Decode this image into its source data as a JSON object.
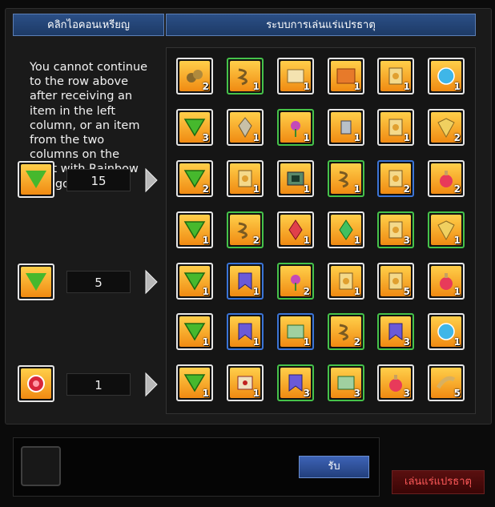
{
  "header": {
    "left_title": "คลิกไอคอนเหรียญ",
    "right_title": "ระบบการเล่นแร่แปรธาตุ"
  },
  "notice_text": "You cannot continue to the row above after receiving an item in the left column, or an item from the two columns on the right with Rainbow Paragon's Soul.",
  "left_rows": [
    {
      "value": "15",
      "icon": "green-down-arrow-icon"
    },
    {
      "value": "5",
      "icon": "green-down-arrow-icon"
    },
    {
      "value": "1",
      "icon": "red-gem-icon"
    }
  ],
  "grid": [
    [
      {
        "icon": "ore-icon",
        "count": "2"
      },
      {
        "icon": "rope-icon",
        "count": "1"
      },
      {
        "icon": "scroll-icon",
        "count": "1"
      },
      {
        "icon": "map-icon",
        "count": "1"
      },
      {
        "icon": "card-icon",
        "count": "1"
      },
      {
        "icon": "orb-icon",
        "count": "1"
      }
    ],
    [
      {
        "icon": "green-down-arrow-icon",
        "count": "3"
      },
      {
        "icon": "drill-icon",
        "count": "1"
      },
      {
        "icon": "flower-icon",
        "count": "1"
      },
      {
        "icon": "robot-icon",
        "count": "1"
      },
      {
        "icon": "card-icon",
        "count": "1"
      },
      {
        "icon": "shield-icon",
        "count": "2"
      }
    ],
    [
      {
        "icon": "green-down-arrow-icon",
        "count": "2"
      },
      {
        "icon": "card-icon",
        "count": "1"
      },
      {
        "icon": "gem-tile-icon",
        "count": "1"
      },
      {
        "icon": "rope-icon",
        "count": "1"
      },
      {
        "icon": "card-icon",
        "count": "2"
      },
      {
        "icon": "potion-icon",
        "count": "2"
      }
    ],
    [
      {
        "icon": "green-down-arrow-icon",
        "count": "1"
      },
      {
        "icon": "rope-icon",
        "count": "2"
      },
      {
        "icon": "red-crystal-icon",
        "count": "1"
      },
      {
        "icon": "green-crystal-icon",
        "count": "1"
      },
      {
        "icon": "card-icon",
        "count": "3"
      },
      {
        "icon": "shield-icon",
        "count": "1"
      }
    ],
    [
      {
        "icon": "green-down-arrow-icon",
        "count": "1"
      },
      {
        "icon": "banner-icon",
        "count": "1"
      },
      {
        "icon": "flower-icon",
        "count": "2"
      },
      {
        "icon": "card-icon",
        "count": "1"
      },
      {
        "icon": "card-icon",
        "count": "5"
      },
      {
        "icon": "potion-icon",
        "count": "1"
      }
    ],
    [
      {
        "icon": "green-down-arrow-icon",
        "count": "1"
      },
      {
        "icon": "banner-icon",
        "count": "1"
      },
      {
        "icon": "cloth-icon",
        "count": "1"
      },
      {
        "icon": "rope-icon",
        "count": "2"
      },
      {
        "icon": "banner-icon",
        "count": "3"
      },
      {
        "icon": "orb-icon",
        "count": "1"
      }
    ],
    [
      {
        "icon": "green-down-arrow-icon",
        "count": "1"
      },
      {
        "icon": "letter-icon",
        "count": "1"
      },
      {
        "icon": "banner-icon",
        "count": "3"
      },
      {
        "icon": "cloth-icon",
        "count": "3"
      },
      {
        "icon": "potion-icon",
        "count": "3"
      },
      {
        "icon": "horn-icon",
        "count": "5"
      }
    ]
  ],
  "grid_border": [
    [
      "white",
      "green",
      "white",
      "white",
      "white",
      "white"
    ],
    [
      "white",
      "white",
      "green",
      "white",
      "white",
      "white"
    ],
    [
      "white",
      "white",
      "white",
      "green",
      "blue",
      "white"
    ],
    [
      "white",
      "green",
      "white",
      "white",
      "green",
      "green"
    ],
    [
      "white",
      "blue",
      "green",
      "white",
      "white",
      "white"
    ],
    [
      "white",
      "blue",
      "blue",
      "green",
      "green",
      "white"
    ],
    [
      "white",
      "white",
      "green",
      "green",
      "white",
      "white"
    ]
  ],
  "buttons": {
    "receive": "รับ",
    "play": "เล่นแร่แปรธาตุ"
  }
}
